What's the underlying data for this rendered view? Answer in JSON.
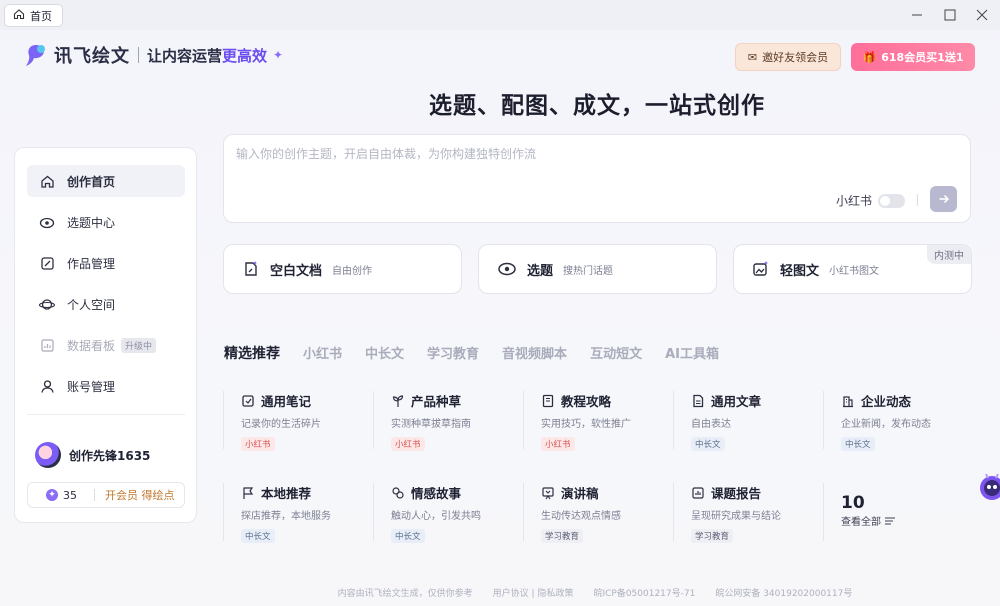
{
  "titlebar": {
    "tab_label": "首页"
  },
  "header": {
    "brand": "讯飞绘文",
    "slogan_prefix": "让内容运营",
    "slogan_highlight": "更高效",
    "invite_label": "邀好友领会员",
    "promo_label": "618会员买1送1"
  },
  "headline": "选题、配图、成文，一站式创作",
  "sidebar": {
    "items": [
      {
        "label": "创作首页",
        "icon": "home-icon"
      },
      {
        "label": "选题中心",
        "icon": "eye-icon"
      },
      {
        "label": "作品管理",
        "icon": "edit-icon"
      },
      {
        "label": "个人空间",
        "icon": "planet-icon"
      },
      {
        "label": "数据看板",
        "icon": "chart-icon",
        "badge": "升级中"
      },
      {
        "label": "账号管理",
        "icon": "user-icon"
      }
    ],
    "user_name": "创作先锋1635",
    "points": "35",
    "points_link_a": "开会员",
    "points_link_b": "得绘点"
  },
  "prompt": {
    "placeholder": "输入你的创作主题，开启自由体裁，为你构建独特创作流",
    "toggle_label": "小红书"
  },
  "quick_cards": [
    {
      "title": "空白文档",
      "subtitle": "自由创作",
      "icon": "new-doc-icon"
    },
    {
      "title": "选题",
      "subtitle": "搜热门话题",
      "icon": "eye-icon"
    },
    {
      "title": "轻图文",
      "subtitle": "小红书图文",
      "icon": "image-text-icon",
      "tag": "内测中"
    }
  ],
  "category_tabs": [
    "精选推荐",
    "小红书",
    "中长文",
    "学习教育",
    "音视频脚本",
    "互动短文",
    "AI工具箱"
  ],
  "templates": [
    {
      "title": "通用笔记",
      "desc": "记录你的生活碎片",
      "tag": "小红书",
      "tag_type": "xhs"
    },
    {
      "title": "产品种草",
      "desc": "实测种草拔草指南",
      "tag": "小红书",
      "tag_type": "xhs"
    },
    {
      "title": "教程攻略",
      "desc": "实用技巧，软性推广",
      "tag": "小红书",
      "tag_type": "xhs"
    },
    {
      "title": "通用文章",
      "desc": "自由表达",
      "tag": "中长文",
      "tag_type": "long"
    },
    {
      "title": "企业动态",
      "desc": "企业新闻，发布动态",
      "tag": "中长文",
      "tag_type": "long"
    },
    {
      "title": "本地推荐",
      "desc": "探店推荐，本地服务",
      "tag": "中长文",
      "tag_type": "long"
    },
    {
      "title": "情感故事",
      "desc": "触动人心，引发共鸣",
      "tag": "中长文",
      "tag_type": "long"
    },
    {
      "title": "演讲稿",
      "desc": "生动传达观点情感",
      "tag": "学习教育",
      "tag_type": "edu"
    },
    {
      "title": "课题报告",
      "desc": "呈现研究成果与结论",
      "tag": "学习教育",
      "tag_type": "edu"
    }
  ],
  "more": {
    "count": "10",
    "label": "查看全部"
  },
  "footer": {
    "disclaimer": "内容由讯飞绘文生成，仅供你参考",
    "agreement": "用户协议",
    "privacy": "隐私政策",
    "icp": "皖ICP备05001217号-71",
    "police": "皖公网安备 34019202000117号"
  }
}
